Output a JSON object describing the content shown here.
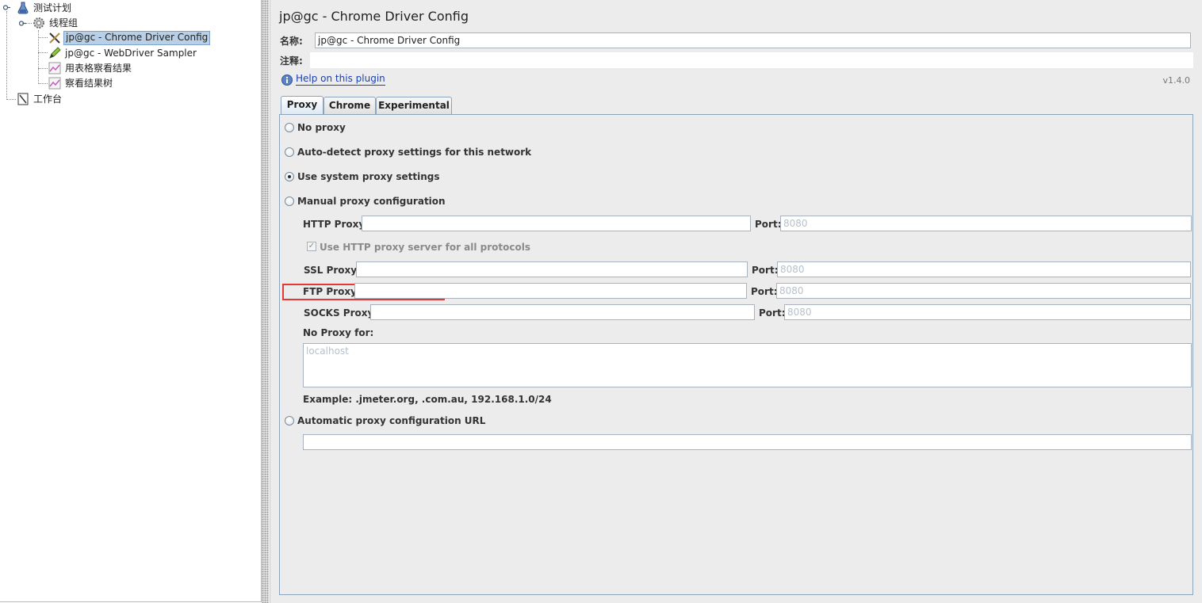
{
  "tree": {
    "items": [
      {
        "label": "测试计划",
        "icon": "flask-icon"
      },
      {
        "label": "线程组",
        "icon": "gear-icon"
      },
      {
        "label": "jp@gc - Chrome Driver Config",
        "icon": "wrench-screwdriver-icon",
        "selected": true
      },
      {
        "label": "jp@gc - WebDriver Sampler",
        "icon": "pen-icon"
      },
      {
        "label": "用表格察看结果",
        "icon": "chart-icon"
      },
      {
        "label": "察看结果树",
        "icon": "chart-icon"
      },
      {
        "label": "工作台",
        "icon": "notebook-icon"
      }
    ]
  },
  "panel": {
    "title": "jp@gc - Chrome Driver Config",
    "name_label": "名称:",
    "name_value": "jp@gc - Chrome Driver Config",
    "comment_label": "注释:",
    "comment_value": "",
    "help_link": "Help on this plugin",
    "version": "v1.4.0"
  },
  "tabs": [
    {
      "label": "Proxy",
      "active": true
    },
    {
      "label": "Chrome",
      "active": false
    },
    {
      "label": "Experimental",
      "active": false
    }
  ],
  "proxy": {
    "no_proxy": "No proxy",
    "auto_detect": "Auto-detect proxy settings for this network",
    "use_system": "Use system proxy settings",
    "manual": "Manual proxy configuration",
    "selected": "use_system",
    "http_label": "HTTP Proxy:",
    "http_value": "",
    "port_label": "Port:",
    "port_placeholder": "8080",
    "use_http_all": "Use HTTP proxy server for all protocols",
    "use_http_all_checked": true,
    "ssl_label": "SSL Proxy:",
    "ssl_value": "",
    "ftp_label": "FTP Proxy:",
    "ftp_value": "",
    "socks_label": "SOCKS Proxy:",
    "socks_value": "",
    "no_proxy_for_label": "No Proxy for:",
    "no_proxy_for_placeholder": "localhost",
    "example": "Example: .jmeter.org, .com.au, 192.168.1.0/24",
    "auto_url": "Automatic proxy configuration URL",
    "auto_url_value": ""
  },
  "colors": {
    "highlight": "#e53935",
    "selection": "#b8cfe5",
    "link": "#1a3fb0"
  }
}
